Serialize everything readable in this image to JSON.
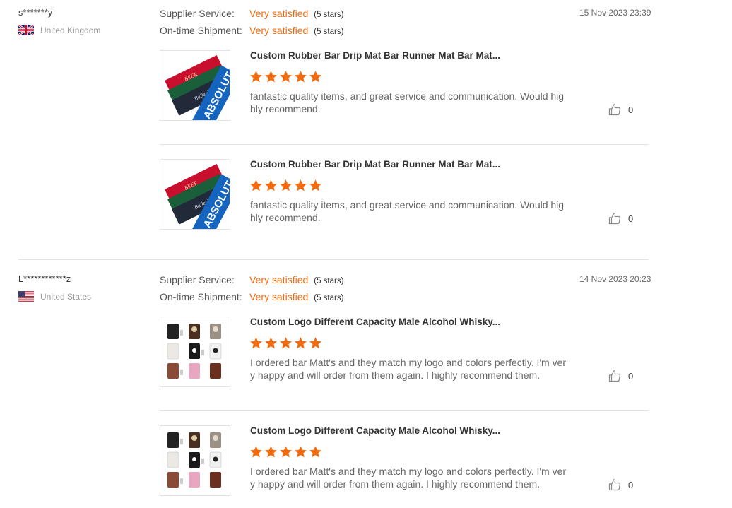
{
  "labels": {
    "supplier_service": "Supplier Service:",
    "ontime_shipment": "On-time Shipment:"
  },
  "colors": {
    "accent": "#f26b0f",
    "divider": "#e2e2e2"
  },
  "reviews": [
    {
      "reviewer": "s*******y",
      "country": "United Kingdom",
      "flag_icon": "uk-flag-icon",
      "supplier_service": "Very satisfied",
      "supplier_service_stars": "(5 stars)",
      "ontime_shipment": "Very satisfied",
      "ontime_shipment_stars": "(5 stars)",
      "date": "15 Nov 2023 23:39",
      "items": [
        {
          "product": "Custom Rubber Bar Drip Mat Bar Runner Mat Bar Mat...",
          "rating": 5,
          "comment": "fantastic quality items,  and great service and communication. Would highly recommend.",
          "likes": "0"
        },
        {
          "product": "Custom Rubber Bar Drip Mat Bar Runner Mat Bar Mat...",
          "rating": 5,
          "comment": "fantastic quality items,  and great service and communication. Would highly recommend.",
          "likes": "0"
        }
      ]
    },
    {
      "reviewer": "L************z",
      "country": "United States",
      "flag_icon": "us-flag-icon",
      "supplier_service": "Very satisfied",
      "supplier_service_stars": "(5 stars)",
      "ontime_shipment": "Very satisfied",
      "ontime_shipment_stars": "(5 stars)",
      "date": "14 Nov 2023 20:23",
      "items": [
        {
          "product": "Custom Logo Different Capacity Male Alcohol Whisky...",
          "rating": 5,
          "comment": "I ordered bar Matt's and they match my logo and colors perfectly. I'm very happy and will order from them again. I highly recommend them.",
          "likes": "0"
        },
        {
          "product": "Custom Logo Different Capacity Male Alcohol Whisky...",
          "rating": 5,
          "comment": "I ordered bar Matt's and they match my logo and colors perfectly. I'm very happy and will order from them again. I highly recommend them.",
          "likes": "0"
        }
      ]
    }
  ]
}
